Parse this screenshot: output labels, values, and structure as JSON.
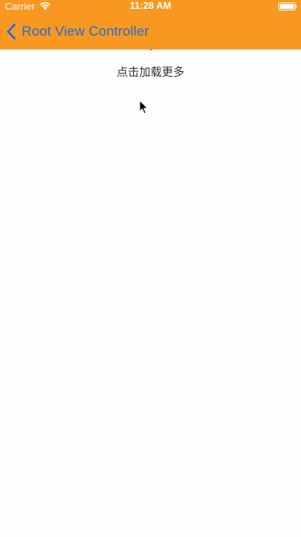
{
  "status_bar": {
    "carrier": "Carrier",
    "time": "11:28 AM",
    "wifi_icon": "wifi-icon",
    "battery_icon": "battery-icon"
  },
  "nav_bar": {
    "back_label": "Root View Controller",
    "back_icon": "chevron-left-icon"
  },
  "content": {
    "load_more_label": "点击加载更多"
  },
  "colors": {
    "nav_background": "#f89820",
    "back_tint": "#1f6fd6",
    "content_background": "#fdfdfd",
    "text": "#333333"
  }
}
